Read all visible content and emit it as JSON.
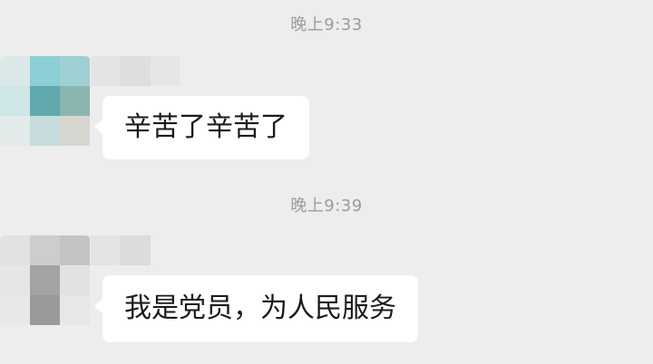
{
  "messages": [
    {
      "timestamp": "晚上9:33",
      "text": "辛苦了辛苦了"
    },
    {
      "timestamp": "晚上9:39",
      "text": "我是党员，为人民服务"
    }
  ],
  "colors": {
    "background": "#ededed",
    "bubble": "#ffffff",
    "timestamp_text": "#9b9b9b",
    "message_text": "#1b1b1b"
  },
  "avatars": [
    {
      "icon": "pixelated-avatar",
      "blurred": true
    },
    {
      "icon": "pixelated-avatar",
      "blurred": true
    }
  ]
}
